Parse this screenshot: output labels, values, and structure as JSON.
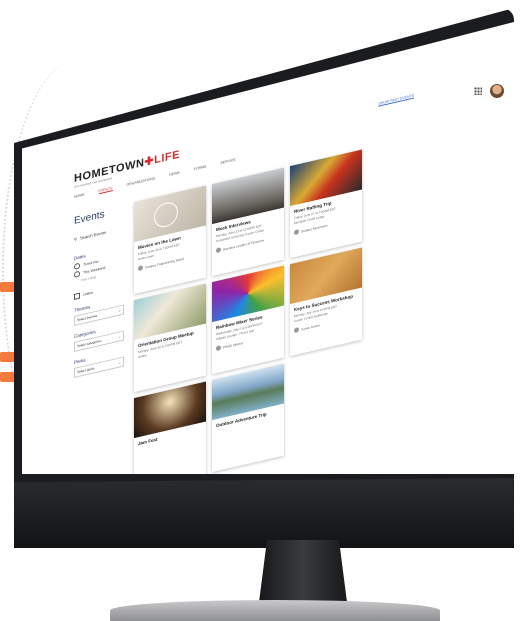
{
  "brand": {
    "name_part1": "HOMETOWN",
    "name_part2": "LIFE",
    "tagline": "Get involved. Get connected."
  },
  "nav": [
    "HOME",
    "EVENTS",
    "ORGANIZATIONS",
    "NEWS",
    "FORMS",
    "SERVICE"
  ],
  "show_past": "SHOW PAST EVENTS",
  "sidebar": {
    "title": "Events",
    "search_placeholder": "Search Events",
    "dates_label": "Dates",
    "date_opts": [
      "Tomorrow",
      "This Weekend"
    ],
    "date_pick": "Pick a Date",
    "online": "Online",
    "themes_label": "Themes",
    "themes_select": "Select themes",
    "categories_label": "Categories",
    "categories_select": "Select categories",
    "perks_label": "Perks",
    "perks_select": "Select perks"
  },
  "events": [
    {
      "title": "Movies on the Lawn",
      "date": "Friday, June 20 at 7:00PM EDT",
      "place": "Union Lawn",
      "org": "Campus Programming Board",
      "img": "movies"
    },
    {
      "title": "Mock Interviews",
      "date": "Monday, June 23 at 12:00PM EDT",
      "place": "Hometown University Career Center",
      "org": "Business Leaders of Tomorrow",
      "img": "mock"
    },
    {
      "title": "River Rafting Trip",
      "date": "Friday, June 27 at 7:00AM EDT",
      "place": "Mountain Creek Lodge",
      "org": "Outdoor Adventures",
      "img": "river"
    },
    {
      "title": "Orientation Group Meetup",
      "date": "Monday, June 30 at 5:00PM EDT",
      "place": "Online",
      "org": "",
      "img": "group"
    },
    {
      "title": "Rainbow Mixer Series",
      "date": "Wednesday, July 2 at 5:00PM EDT",
      "place": "Hillgate Lounge - Pierce Hall",
      "org": "PRIDE Alliance",
      "img": "rainbow"
    },
    {
      "title": "Keys to Success Workshop",
      "date": "Monday, July 14 at 3:00PM EDT",
      "place": "Career Center Auditorium",
      "org": "Career Center",
      "img": "keys"
    },
    {
      "title": "Jam Fest",
      "date": "",
      "place": "",
      "org": "",
      "img": "jam"
    },
    {
      "title": "Outdoor Adventure Trip",
      "date": "",
      "place": "",
      "org": "",
      "img": "lake"
    }
  ]
}
